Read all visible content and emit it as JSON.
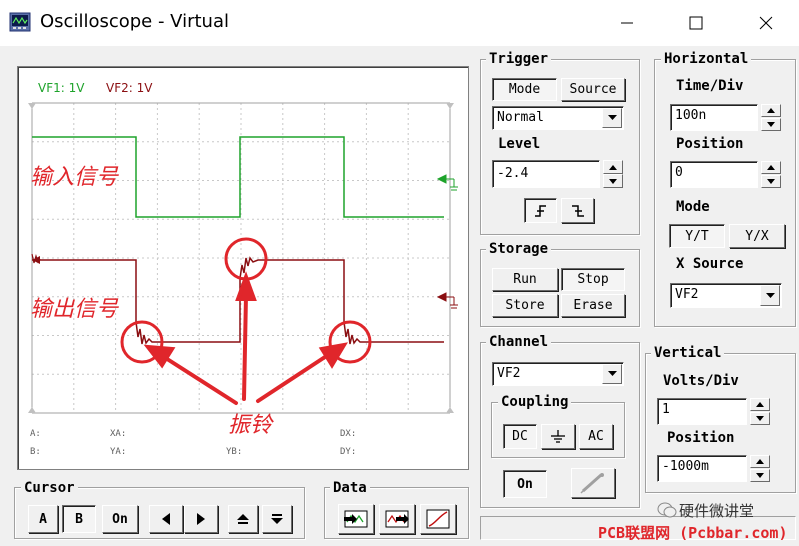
{
  "window": {
    "title": "Oscilloscope - Virtual"
  },
  "screen": {
    "label_vf1": "VF1: 1V",
    "label_vf2": "VF2: 1V",
    "colors": {
      "vf1": "#1ea32b",
      "vf2": "#8b0f12",
      "grid": "#c8c8c8",
      "annotation": "#e0262b"
    },
    "cursor_labels": {
      "a": "A:",
      "xa": "XA:",
      "dx": "DX:",
      "b": "B:",
      "ya": "YA:",
      "yb": "YB:",
      "dy": "DY:"
    }
  },
  "annotations": {
    "input_signal": "输入信号",
    "output_signal": "输出信号",
    "ringing": "振铃"
  },
  "trigger": {
    "group_label": "Trigger",
    "mode_button": "Mode",
    "source_button": "Source",
    "mode_value": "Normal",
    "level_label": "Level",
    "level_value": "-2.4"
  },
  "storage": {
    "group_label": "Storage",
    "run": "Run",
    "stop": "Stop",
    "store": "Store",
    "erase": "Erase"
  },
  "channel": {
    "group_label": "Channel",
    "channel_value": "VF2",
    "coupling_label": "Coupling",
    "dc": "DC",
    "ac": "AC",
    "on": "On"
  },
  "horizontal": {
    "group_label": "Horizontal",
    "time_div_label": "Time/Div",
    "time_div_value": "100n",
    "position_label": "Position",
    "position_value": "0",
    "mode_label": "Mode",
    "yt": "Y/T",
    "yx": "Y/X",
    "x_source_label": "X Source",
    "x_source_value": "VF2"
  },
  "vertical": {
    "group_label": "Vertical",
    "volts_div_label": "Volts/Div",
    "volts_div_value": "1",
    "position_label": "Position",
    "position_value": "-1000m"
  },
  "cursor": {
    "group_label": "Cursor",
    "a": "A",
    "b": "B",
    "on": "On"
  },
  "data": {
    "group_label": "Data"
  },
  "watermark": {
    "wechat": "硬件微讲堂",
    "site": "PCB联盟网 (Pcbbar.com)"
  }
}
